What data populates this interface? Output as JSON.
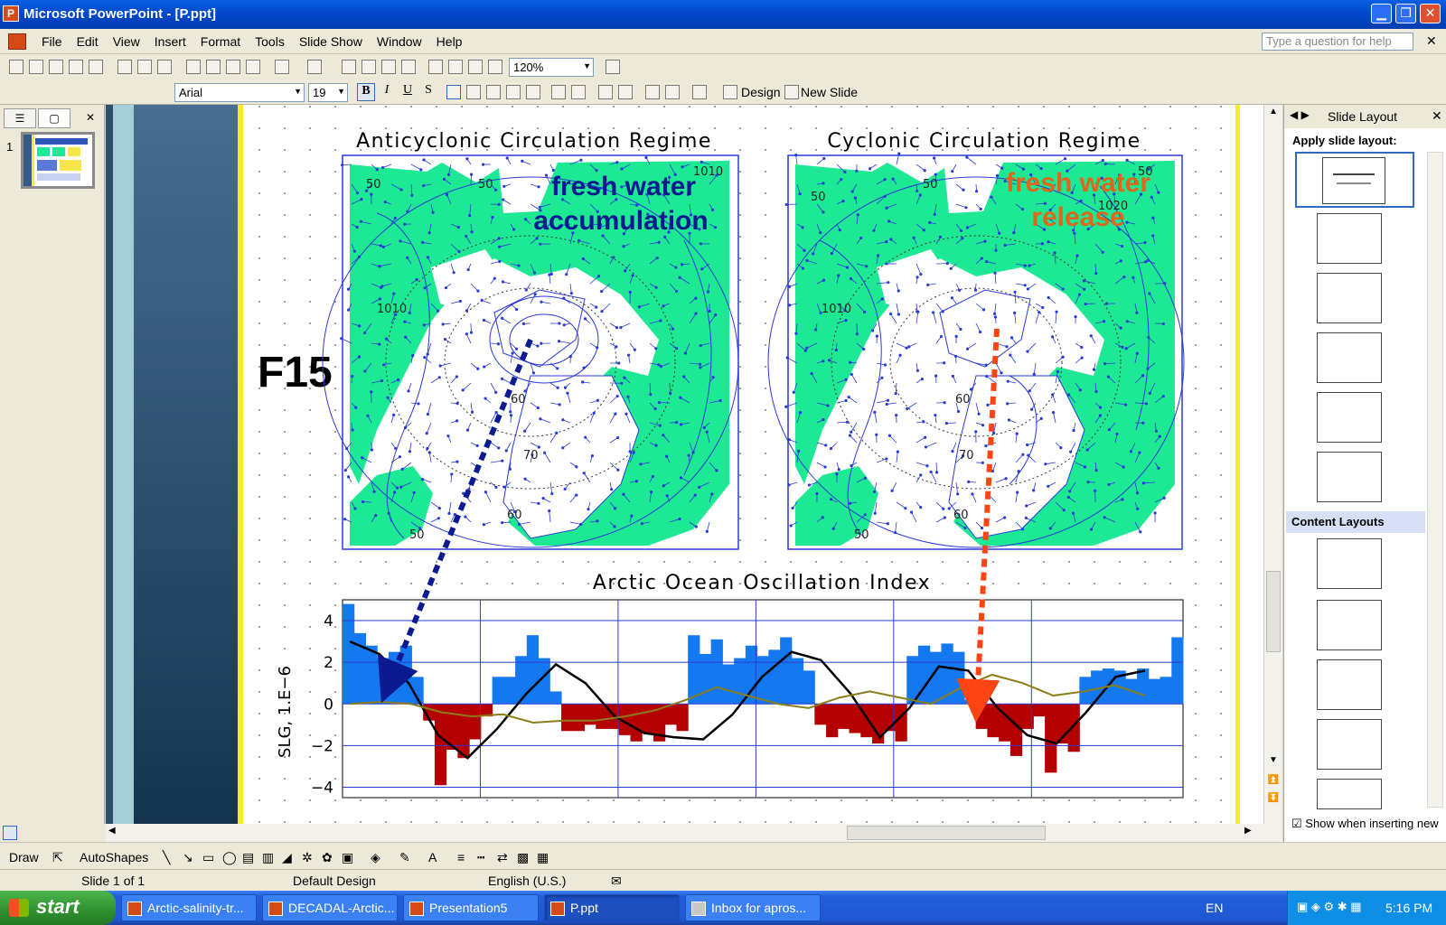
{
  "window": {
    "title": "Microsoft PowerPoint - [P.ppt]"
  },
  "menu": {
    "items": [
      "File",
      "Edit",
      "View",
      "Insert",
      "Format",
      "Tools",
      "Slide Show",
      "Window",
      "Help"
    ],
    "help_placeholder": "Type a question for help"
  },
  "toolbar": {
    "zoom": "120%",
    "font": "Arial",
    "font_size": "19",
    "design_label": "Design",
    "new_slide_label": "New Slide"
  },
  "slides_pane": {
    "slide_number": "1"
  },
  "slide": {
    "label": "F15",
    "map_left": {
      "title": "Anticyclonic Circulation Regime",
      "annotation_line1": "fresh water",
      "annotation_line2": "accumulation",
      "contours": [
        "50",
        "50",
        "1010",
        "60",
        "70",
        "60",
        "50",
        "1010"
      ]
    },
    "map_right": {
      "title": "Cyclonic Circulation Regime",
      "annotation_line1": "fresh water",
      "annotation_line2": "release",
      "contours": [
        "50",
        "50",
        "50",
        "1020",
        "1010",
        "60",
        "70",
        "60",
        "50"
      ]
    },
    "colors": {
      "annotation_left": "#0b1a8f",
      "annotation_right": "#e0661a",
      "land": "#1de894",
      "arrow_left": "#0b1a8f",
      "arrow_right": "#ff4414"
    }
  },
  "chart_data": {
    "type": "bar",
    "title": "Arctic Ocean Oscillation Index",
    "ylabel": "SLG, 1.E−6",
    "xlabel": "",
    "ylim": [
      -4.5,
      5
    ],
    "yticks": [
      "4",
      "2",
      "0",
      "−2",
      "−4"
    ],
    "grid": true,
    "values": [
      4.8,
      3.4,
      2.8,
      2.2,
      2.5,
      2.8,
      1.3,
      -0.8,
      -3.9,
      -2.2,
      -2.6,
      -1.7,
      -0.6,
      1.3,
      1.3,
      2.3,
      3.3,
      2.2,
      0.6,
      -1.3,
      -1.3,
      -1.0,
      -1.2,
      -1.2,
      -1.5,
      -1.8,
      -1.4,
      -1.8,
      -1.0,
      -1.3,
      3.3,
      2.4,
      3.1,
      1.9,
      2.2,
      2.8,
      2.3,
      2.6,
      3.2,
      2.2,
      1.6,
      -1.0,
      -1.6,
      -1.2,
      -1.4,
      -1.6,
      -1.9,
      -1.3,
      -1.8,
      2.3,
      2.8,
      2.5,
      2.9,
      2.5,
      0.2,
      -1.2,
      -1.6,
      -1.8,
      -2.5,
      -1.2,
      -0.6,
      -3.3,
      -1.9,
      -2.3,
      1.3,
      1.6,
      1.7,
      1.6,
      1.2,
      1.7,
      1.2,
      1.3,
      3.2
    ],
    "series": [
      {
        "name": "",
        "color": "#000000",
        "values": [
          3.0,
          2.4,
          1.0,
          -1.5,
          -2.6,
          -1.2,
          0.5,
          1.9,
          1.0,
          -0.6,
          -1.4,
          -1.6,
          -1.7,
          -0.5,
          1.3,
          2.5,
          2.1,
          0.5,
          -1.6,
          -0.2,
          1.8,
          1.6,
          -0.2,
          -1.5,
          -1.9,
          -0.4,
          1.3,
          1.6
        ]
      },
      {
        "name": "",
        "color": "#8a7d1a",
        "values": [
          0.0,
          0.1,
          0.0,
          -0.4,
          -0.6,
          -0.5,
          -0.9,
          -0.8,
          -0.8,
          -0.6,
          -0.3,
          0.2,
          0.8,
          0.4,
          0.0,
          -0.2,
          0.3,
          0.6,
          0.3,
          0.0,
          0.8,
          1.4,
          1.0,
          0.4,
          0.6,
          0.9,
          0.4
        ]
      }
    ]
  },
  "task_pane": {
    "title": "Slide Layout",
    "apply_label": "Apply slide layout:",
    "content_layouts": "Content Layouts",
    "show_label": "Show when inserting new"
  },
  "drawbar": {
    "draw": "Draw",
    "autoshapes": "AutoShapes"
  },
  "status": {
    "slide": "Slide 1 of 1",
    "design": "Default Design",
    "language": "English (U.S.)"
  },
  "taskbar": {
    "start": "start",
    "tasks": [
      "Arctic-salinity-tr...",
      "DECADAL-Arctic...",
      "Presentation5",
      "P.ppt",
      "Inbox for apros..."
    ],
    "lang": "EN",
    "clock": "5:16 PM"
  }
}
